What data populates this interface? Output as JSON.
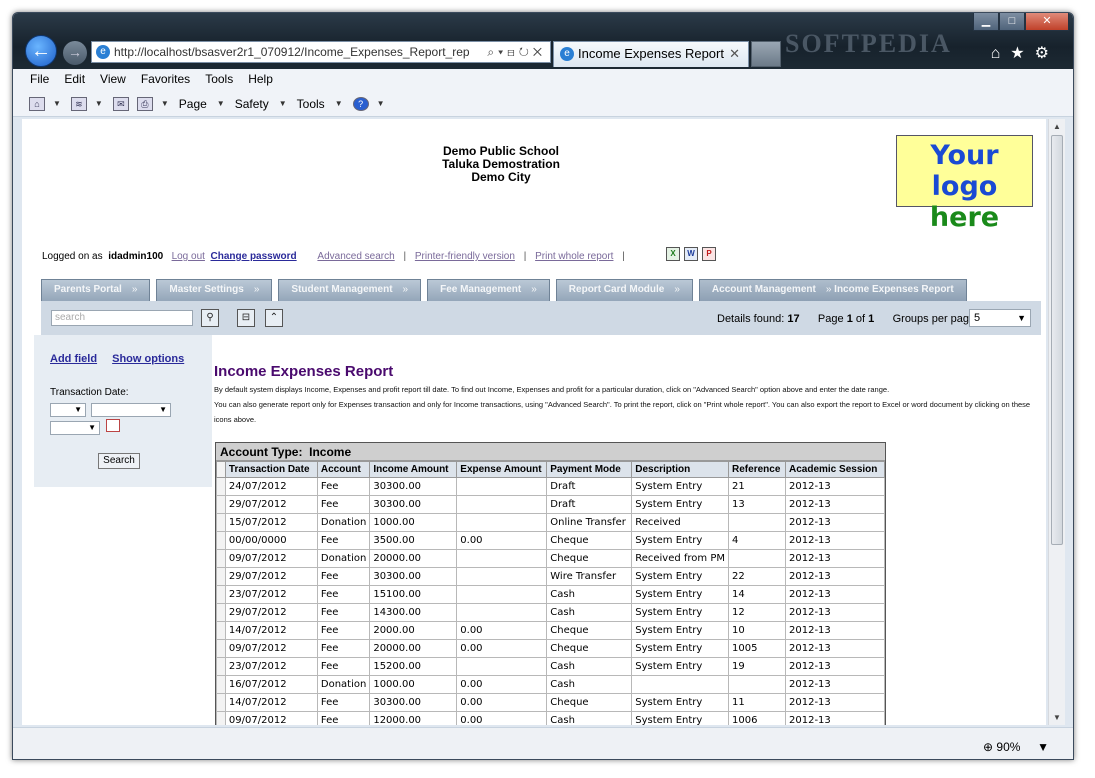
{
  "browser": {
    "url": "http://localhost/bsasver2r1_070912/Income_Expenses_Report_rep",
    "tab_title": "Income Expenses Report",
    "watermark": "SOFTPEDIA",
    "menu": [
      "File",
      "Edit",
      "View",
      "Favorites",
      "Tools",
      "Help"
    ],
    "commands": [
      "Page",
      "Safety",
      "Tools"
    ],
    "zoom": "90%"
  },
  "school": {
    "name": "Demo Public School",
    "taluka": "Taluka Demostration",
    "city": "Demo City",
    "logo_line1": "Your logo",
    "logo_line2": "here"
  },
  "login": {
    "prefix": "Logged on as",
    "user": "idadmin100",
    "logout": "Log out",
    "change_password": "Change password",
    "advanced_search": "Advanced search",
    "printer_friendly": "Printer-friendly version",
    "print_whole": "Print whole report"
  },
  "nav_tabs": [
    "Parents Portal",
    "Master Settings",
    "Student Management",
    "Fee Management",
    "Report Card Module",
    "Account Management"
  ],
  "nav_current": "Income Expenses Report",
  "toolbar": {
    "search_placeholder": "search",
    "details_label": "Details found:",
    "details_count": "17",
    "page_label": "Page",
    "page_current": "1",
    "page_of": "of",
    "page_total": "1",
    "groups_label": "Groups per page:",
    "groups_value": "5"
  },
  "left_panel": {
    "add_field": "Add field",
    "show_options": "Show options",
    "transaction_date_label": "Transaction Date:",
    "search_button": "Search"
  },
  "report": {
    "title": "Income Expenses Report",
    "desc1": "By default system displays Income, Expenses and profit report till date. To find out Income, Expenses and profit for a particular duration, click on \"Advanced Search\" option above and enter the date range.",
    "desc2": "You can also generate report only for Expenses transaction and only for Income transactions, using \"Advanced Search\".  To print the report, click on \"Print whole report\". You can also export  the report to Excel or word document by clicking on these icons above.",
    "account_type_label": "Account Type:",
    "account_type_value": "Income",
    "columns": [
      "Transaction Date",
      "Account",
      "Income Amount",
      "Expense Amount",
      "Payment Mode",
      "Description",
      "Reference",
      "Academic Session"
    ],
    "rows": [
      [
        "24/07/2012",
        "Fee",
        "30300.00",
        "",
        "Draft",
        "System Entry",
        "21",
        "2012-13"
      ],
      [
        "29/07/2012",
        "Fee",
        "30300.00",
        "",
        "Draft",
        "System Entry",
        "13",
        "2012-13"
      ],
      [
        "15/07/2012",
        "Donation",
        "1000.00",
        "",
        "Online Transfer",
        "Received",
        "",
        "2012-13"
      ],
      [
        "00/00/0000",
        "Fee",
        "3500.00",
        "0.00",
        "Cheque",
        "System Entry",
        "4",
        "2012-13"
      ],
      [
        "09/07/2012",
        "Donation",
        "20000.00",
        "",
        "Cheque",
        "Received from PM",
        "",
        "2012-13"
      ],
      [
        "29/07/2012",
        "Fee",
        "30300.00",
        "",
        "Wire Transfer",
        "System Entry",
        "22",
        "2012-13"
      ],
      [
        "23/07/2012",
        "Fee",
        "15100.00",
        "",
        "Cash",
        "System Entry",
        "14",
        "2012-13"
      ],
      [
        "29/07/2012",
        "Fee",
        "14300.00",
        "",
        "Cash",
        "System Entry",
        "12",
        "2012-13"
      ],
      [
        "14/07/2012",
        "Fee",
        "2000.00",
        "0.00",
        "Cheque",
        "System Entry",
        "10",
        "2012-13"
      ],
      [
        "09/07/2012",
        "Fee",
        "20000.00",
        "0.00",
        "Cheque",
        "System Entry",
        "1005",
        "2012-13"
      ],
      [
        "23/07/2012",
        "Fee",
        "15200.00",
        "",
        "Cash",
        "System Entry",
        "19",
        "2012-13"
      ],
      [
        "16/07/2012",
        "Donation",
        "1000.00",
        "0.00",
        "Cash",
        "",
        "",
        "2012-13"
      ],
      [
        "14/07/2012",
        "Fee",
        "30300.00",
        "0.00",
        "Cheque",
        "System Entry",
        "11",
        "2012-13"
      ],
      [
        "09/07/2012",
        "Fee",
        "12000.00",
        "0.00",
        "Cash",
        "System Entry",
        "1006",
        "2012-13"
      ]
    ]
  }
}
